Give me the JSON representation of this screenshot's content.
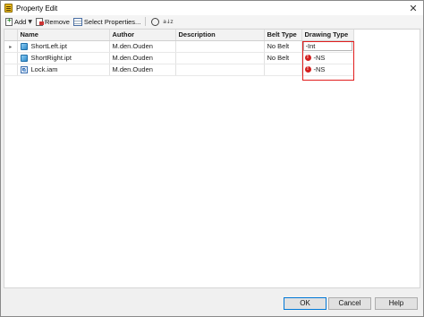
{
  "window": {
    "title": "Property Edit",
    "close_glyph": "✕"
  },
  "toolbar": {
    "add_label": "Add",
    "add_dropdown_glyph": "▼",
    "remove_label": "Remove",
    "select_properties_label": "Select Properties...",
    "search_icon": "search-icon",
    "sort_icon_text": "a↓z"
  },
  "grid": {
    "columns": [
      "Name",
      "Author",
      "Description",
      "Belt Type",
      "Drawing Type"
    ],
    "rows": [
      {
        "expand": "▸",
        "icon": "part-icon",
        "name": "ShortLeft.ipt",
        "author": "M.den.Ouden",
        "description": "",
        "belt_type": "No Belt",
        "drawing_type": "-Int",
        "editing": true,
        "error": false
      },
      {
        "expand": "",
        "icon": "part-icon",
        "name": "ShortRight.ipt",
        "author": "M.den.Ouden",
        "description": "",
        "belt_type": "No Belt",
        "drawing_type": "-NS",
        "editing": false,
        "error": true
      },
      {
        "expand": "",
        "icon": "assembly-icon",
        "name": "Lock.iam",
        "author": "M.den.Ouden",
        "description": "",
        "belt_type": "",
        "drawing_type": "-NS",
        "editing": false,
        "error": true
      }
    ],
    "error_glyph": "!",
    "highlight_color": "#e11d1d"
  },
  "footer": {
    "ok_label": "OK",
    "cancel_label": "Cancel",
    "help_label": "Help"
  }
}
